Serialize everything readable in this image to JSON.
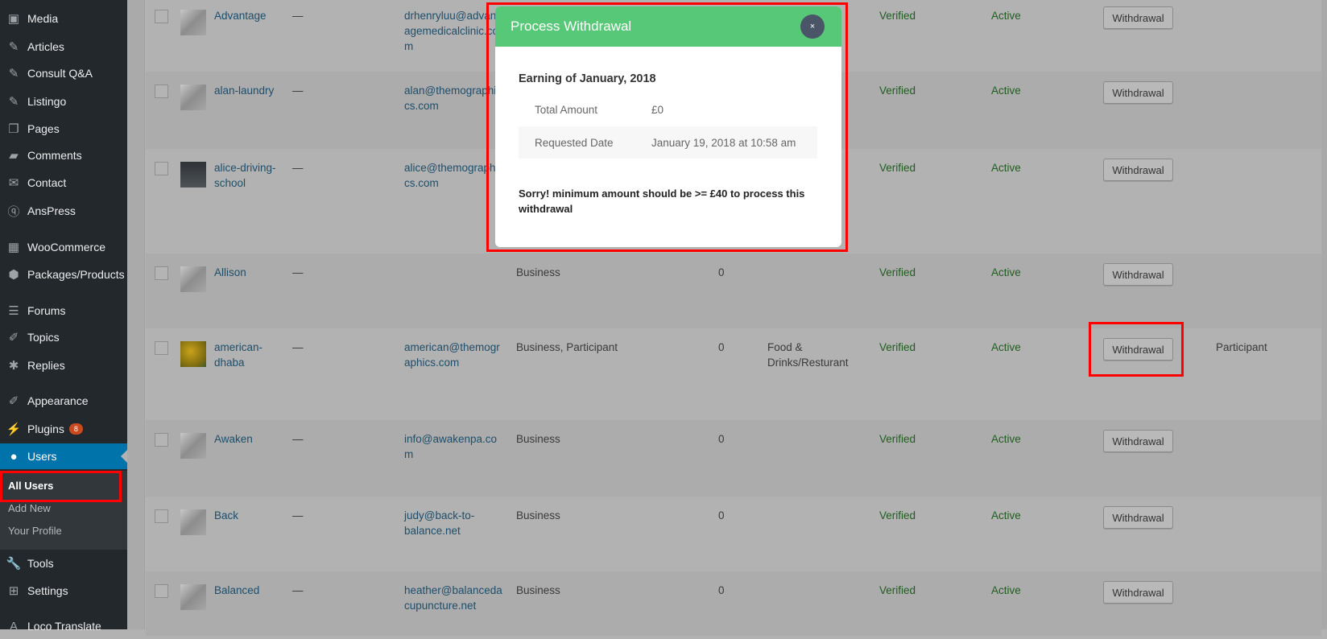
{
  "sidebar": {
    "items": [
      {
        "label": "Media",
        "icon": "media-icon",
        "glyph": "▣"
      },
      {
        "label": "Articles",
        "icon": "pin-icon",
        "glyph": "✎"
      },
      {
        "label": "Consult Q&A",
        "icon": "pin-icon",
        "glyph": "✎"
      },
      {
        "label": "Listingo",
        "icon": "pin-icon",
        "glyph": "✎"
      },
      {
        "label": "Pages",
        "icon": "pages-icon",
        "glyph": "❐"
      },
      {
        "label": "Comments",
        "icon": "comment-icon",
        "glyph": "▰"
      },
      {
        "label": "Contact",
        "icon": "mail-icon",
        "glyph": "✉"
      },
      {
        "label": "AnsPress",
        "icon": "anspress-icon",
        "glyph": "ⓠ"
      },
      {
        "label": "WooCommerce",
        "icon": "woo-icon",
        "glyph": "▦"
      },
      {
        "label": "Packages/Products",
        "icon": "box-icon",
        "glyph": "⬢"
      },
      {
        "label": "Forums",
        "icon": "forums-icon",
        "glyph": "☰"
      },
      {
        "label": "Topics",
        "icon": "topics-icon",
        "glyph": "✐"
      },
      {
        "label": "Replies",
        "icon": "replies-icon",
        "glyph": "✱"
      },
      {
        "label": "Appearance",
        "icon": "brush-icon",
        "glyph": "✐"
      },
      {
        "label": "Plugins",
        "icon": "plug-icon",
        "glyph": "⚡",
        "badge": "8"
      },
      {
        "label": "Users",
        "icon": "user-icon",
        "glyph": "●",
        "current": true
      },
      {
        "label": "Tools",
        "icon": "wrench-icon",
        "glyph": "🔧"
      },
      {
        "label": "Settings",
        "icon": "settings-icon",
        "glyph": "⊞"
      },
      {
        "label": "Loco Translate",
        "icon": "translate-icon",
        "glyph": "A"
      }
    ],
    "submenu": [
      {
        "label": "All Users",
        "current": true
      },
      {
        "label": "Add New"
      },
      {
        "label": "Your Profile"
      }
    ]
  },
  "users": [
    {
      "name": "Advantage",
      "dash": "—",
      "email": "drhenryluu@advant agemedicalclinic.co m",
      "type": "",
      "count": "",
      "category": "",
      "verified": "Verified",
      "status": "Active",
      "action": "Withdrawal",
      "role": "",
      "avatar": "g"
    },
    {
      "name": "alan-laundry",
      "dash": "—",
      "email": "alan@themographi cs.com",
      "type": "",
      "count": "",
      "category": "",
      "verified": "Verified",
      "status": "Active",
      "action": "Withdrawal",
      "role": "",
      "avatar": "g"
    },
    {
      "name": "alice-driving-school",
      "dash": "—",
      "email": "alice@themographi cs.com",
      "type": "",
      "count": "",
      "category": "",
      "verified": "Verified",
      "status": "Active",
      "action": "Withdrawal",
      "role": "",
      "avatar": "d"
    },
    {
      "name": "Allison",
      "dash": "—",
      "email": "",
      "type": "Business",
      "count": "0",
      "category": "",
      "verified": "Verified",
      "status": "Active",
      "action": "Withdrawal",
      "role": "",
      "avatar": "g"
    },
    {
      "name": "american-dhaba",
      "dash": "—",
      "email": "american@themogr aphics.com",
      "type": "Business, Participant",
      "count": "0",
      "category": "Food & Drinks/Resturant",
      "verified": "Verified",
      "status": "Active",
      "action": "Withdrawal",
      "role": "Participant",
      "avatar": "y"
    },
    {
      "name": "Awaken",
      "dash": "—",
      "email": "info@awakenpa.co m",
      "type": "Business",
      "count": "0",
      "category": "",
      "verified": "Verified",
      "status": "Active",
      "action": "Withdrawal",
      "role": "",
      "avatar": "g"
    },
    {
      "name": "Back",
      "dash": "—",
      "email": "judy@back-to- balance.net",
      "type": "Business",
      "count": "0",
      "category": "",
      "verified": "Verified",
      "status": "Active",
      "action": "Withdrawal",
      "role": "",
      "avatar": "g"
    },
    {
      "name": "Balanced",
      "dash": "—",
      "email": "heather@balanceda cupuncture.net",
      "type": "Business",
      "count": "0",
      "category": "",
      "verified": "Verified",
      "status": "Active",
      "action": "Withdrawal",
      "role": "",
      "avatar": "g"
    }
  ],
  "modal": {
    "title": "Process Withdrawal",
    "close": "×",
    "heading": "Earning of January, 2018",
    "rows": [
      {
        "label": "Total Amount",
        "value": "£0"
      },
      {
        "label": "Requested Date",
        "value": "January 19, 2018 at 10:58 am"
      }
    ],
    "message": "Sorry! minimum amount should be >= £40 to process this withdrawal"
  },
  "colors": {
    "header": "#57c877",
    "highlight": "#ff0000",
    "menu_active": "#0073aa"
  }
}
